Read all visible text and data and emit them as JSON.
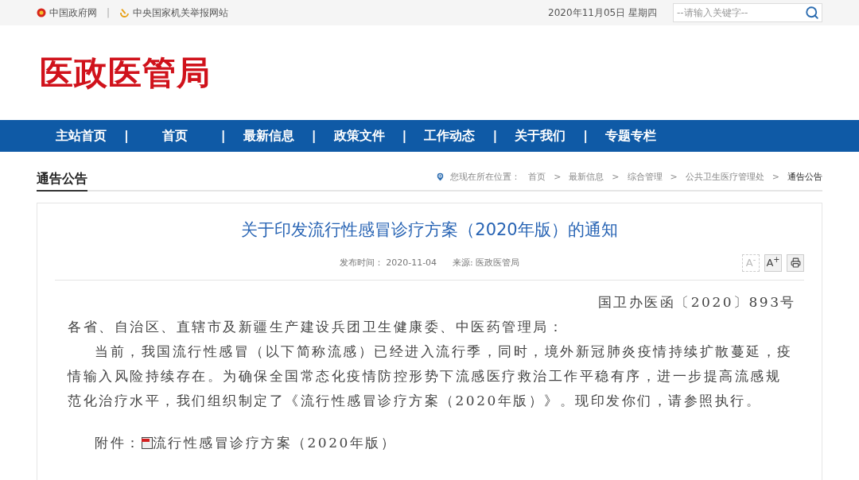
{
  "top_links": [
    {
      "kind": "emblem",
      "label": "中国政府网"
    },
    {
      "kind": "party",
      "label": "中央国家机关举报网站"
    }
  ],
  "separator": "|",
  "date": "2020年11月05日 星期四",
  "search": {
    "placeholder": "--请输入关键字--"
  },
  "site_title": "医政医管局",
  "nav": [
    "主站首页",
    "首页",
    "最新信息",
    "政策文件",
    "工作动态",
    "关于我们",
    "专题专栏"
  ],
  "nav_separator": "|",
  "section_title": "通告公告",
  "breadcrumb": {
    "label": "您现在所在位置：",
    "items": [
      "首页",
      "最新信息",
      "综合管理",
      "公共卫生医疗管理处",
      "通告公告"
    ],
    "separator": ">"
  },
  "article": {
    "title": "关于印发流行性感冒诊疗方案（2020年版）的通知",
    "meta": [
      {
        "label": "发布时间：",
        "value": "2020-11-04"
      },
      {
        "label": "来源:",
        "value": "医政医管局"
      }
    ],
    "tools": [
      {
        "kind": "text",
        "label": "A$^{-}$",
        "disabled": true
      },
      {
        "kind": "text",
        "label": "A$^{+}$",
        "disabled": false
      },
      {
        "kind": "print",
        "disabled": false
      }
    ],
    "doc_number": "国卫办医函〔2020〕893号",
    "salutation": "各省、自治区、直辖市及新疆生产建设兵团卫生健康委、中医药管理局：",
    "paragraph": "当前，我国流行性感冒（以下简称流感）已经进入流行季，同时，境外新冠肺炎疫情持续扩散蔓延，疫情输入风险持续存在。为确保全国常态化疫情防控形势下流感医疗救治工作平稳有序，进一步提高流感规范化治疗水平，我们组织制定了《流行性感冒诊疗方案（2020年版）》。现印发你们，请参照执行。",
    "attachment": {
      "label": "附件：",
      "link": "流行性感冒诊疗方案（2020年版）"
    }
  }
}
